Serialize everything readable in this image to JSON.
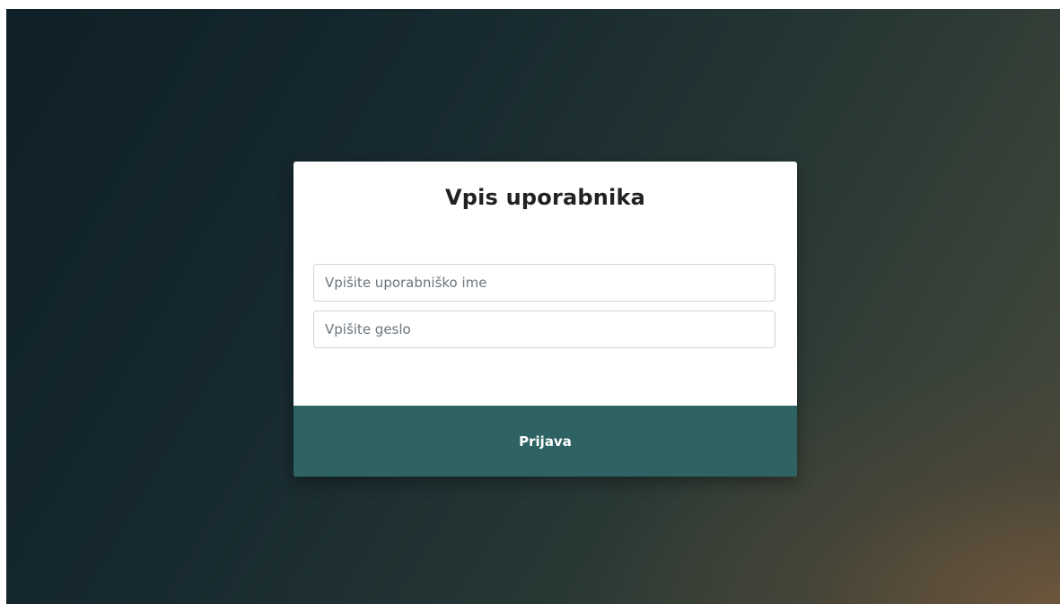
{
  "login": {
    "title": "Vpis uporabnika",
    "username": {
      "value": "",
      "placeholder": "Vpišite uporabniško ime"
    },
    "password": {
      "value": "",
      "placeholder": "Vpišite geslo"
    },
    "submit_label": "Prijava"
  },
  "colors": {
    "accent": "#2f6263",
    "card_bg": "#ffffff",
    "background_dark": "#0f1f27",
    "background_warm": "#6e563c"
  }
}
